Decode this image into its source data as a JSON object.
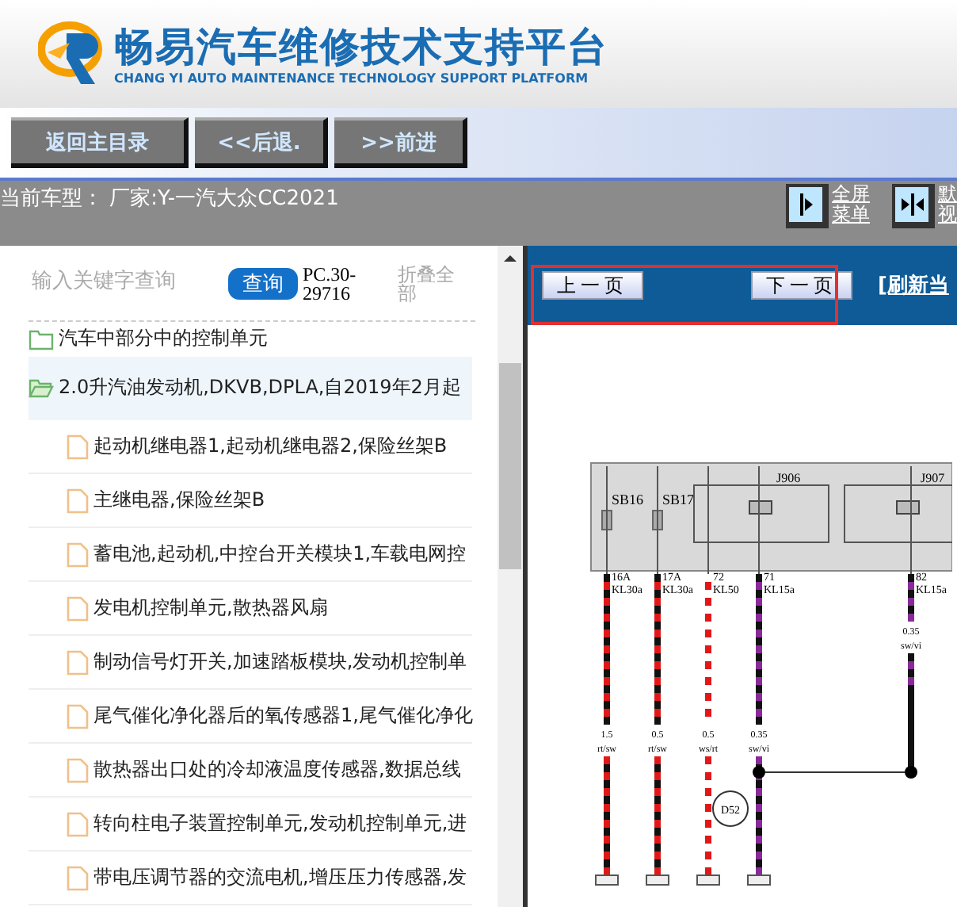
{
  "header": {
    "title": "畅易汽车维修技术支持平台",
    "subtitle": "CHANG YI AUTO MAINTENANCE TECHNOLOGY SUPPORT PLATFORM"
  },
  "nav_buttons": [
    "返回主目录",
    "<<后退.",
    ">>前进"
  ],
  "model_bar": {
    "text": "当前车型： 厂家:Y-一汽大众CC2021",
    "tools": [
      {
        "kind": "single",
        "lines": [
          "全屏",
          "菜单"
        ]
      },
      {
        "kind": "double",
        "lines": [
          "默",
          "视"
        ]
      }
    ]
  },
  "search": {
    "placeholder": "输入关键字查询",
    "button": "查询",
    "code": "PC.30-29716",
    "collapse": "折叠全部"
  },
  "tree": [
    {
      "label": "汽车中部分中的控制单元",
      "expanded": false,
      "selected": false
    },
    {
      "label": "2.0升汽油发动机,DKVB,DPLA,自2019年2月起",
      "expanded": true,
      "selected": true,
      "children": [
        {
          "label": "起动机继电器1,起动机继电器2,保险丝架B"
        },
        {
          "label": "主继电器,保险丝架B"
        },
        {
          "label": "蓄电池,起动机,中控台开关模块1,车载电网控"
        },
        {
          "label": "发电机控制单元,散热器风扇"
        },
        {
          "label": "制动信号灯开关,加速踏板模块,发动机控制单"
        },
        {
          "label": "尾气催化净化器后的氧传感器1,尾气催化净化"
        },
        {
          "label": "散热器出口处的冷却液温度传感器,数据总线"
        },
        {
          "label": "转向柱电子装置控制单元,发动机控制单元,进"
        },
        {
          "label": "带电压调节器的交流电机,增压压力传感器,发"
        }
      ]
    }
  ],
  "pager": {
    "prev": "上一页",
    "next": "下一页",
    "refresh": "[刷新当",
    "highlighted": true
  },
  "diagram": {
    "fuses": [
      "SB16",
      "SB17"
    ],
    "relays": [
      "J906",
      "J907"
    ],
    "connector": "D52",
    "wires": [
      {
        "pin": "16A",
        "terminal": "KL30a",
        "size": "1.5",
        "code": "rt/sw",
        "kind": "red-black"
      },
      {
        "pin": "17A",
        "terminal": "KL30a",
        "size": "0.5",
        "code": "rt/sw",
        "kind": "red-black"
      },
      {
        "pin": "72",
        "terminal": "KL50",
        "size": "0.5",
        "code": "ws/rt",
        "kind": "red-white"
      },
      {
        "pin": "71",
        "terminal": "KL15a",
        "size": "0.35",
        "code": "sw/vi",
        "kind": "violet-black"
      },
      {
        "pin": "82",
        "terminal": "KL15a",
        "size": "0.35",
        "code": "sw/vi",
        "kind": "violet-black"
      }
    ]
  }
}
